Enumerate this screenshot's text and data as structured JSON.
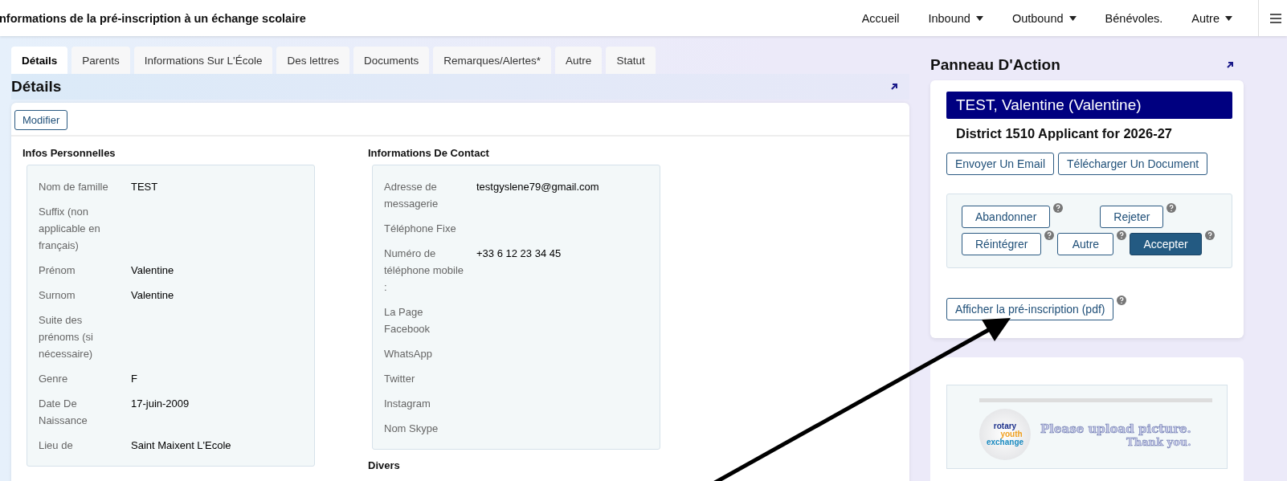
{
  "header": {
    "title": "nformations de la pré-inscription à un échange scolaire",
    "nav": [
      {
        "label": "Accueil",
        "dropdown": false
      },
      {
        "label": "Inbound",
        "dropdown": true
      },
      {
        "label": "Outbound",
        "dropdown": true
      },
      {
        "label": "Bénévoles.",
        "dropdown": false
      },
      {
        "label": "Autre",
        "dropdown": true
      }
    ]
  },
  "tabs": [
    {
      "label": "Détails",
      "selected": true
    },
    {
      "label": "Parents",
      "selected": false
    },
    {
      "label": "Informations Sur L'École",
      "selected": false
    },
    {
      "label": "Des lettres",
      "selected": false
    },
    {
      "label": "Documents",
      "selected": false
    },
    {
      "label": "Remarques/Alertes*",
      "selected": false
    },
    {
      "label": "Autre",
      "selected": false
    },
    {
      "label": "Statut",
      "selected": false
    }
  ],
  "section": {
    "title": "Détails",
    "edit_button": "Modifier"
  },
  "personal": {
    "title": "Infos Personnelles",
    "fields": [
      {
        "label": "Nom de famille",
        "value": "TEST"
      },
      {
        "label": "Suffix (non applicable en français)"
      },
      {
        "label": "Prénom",
        "value": "Valentine"
      },
      {
        "label": "Surnom",
        "value": "Valentine"
      },
      {
        "label": "Suite des prénoms (si nécessaire)"
      },
      {
        "label": "Genre",
        "value": "F"
      },
      {
        "label": "Date De Naissance",
        "value": "17-juin-2009"
      },
      {
        "label": "Lieu de",
        "value": "Saint Maixent L'Ecole"
      }
    ]
  },
  "contact": {
    "title": "Informations De Contact",
    "fields": [
      {
        "label": "Adresse de messagerie",
        "value": "testgyslene79@gmail.com"
      },
      {
        "label": "Téléphone Fixe"
      },
      {
        "label": "Numéro de téléphone mobile :",
        "value": "+33 6 12 23 34 45"
      },
      {
        "label": "La Page Facebook"
      },
      {
        "label": "WhatsApp"
      },
      {
        "label": "Twitter"
      },
      {
        "label": "Instagram"
      },
      {
        "label": "Nom Skype"
      }
    ]
  },
  "next_section": {
    "title": "Divers"
  },
  "action_panel": {
    "title": "Panneau D'Action",
    "name": "TEST, Valentine (Valentine)",
    "subtitle": "District 1510 Applicant for 2026-27",
    "buttons": [
      "Envoyer Un Email",
      "Télécharger Un Document"
    ],
    "status_actions": [
      [
        {
          "label": "Abandonner",
          "primary": false
        },
        {
          "label": "Rejeter",
          "primary": false
        }
      ],
      [
        {
          "label": "Réintégrer",
          "primary": false
        },
        {
          "label": "Autre",
          "primary": false
        },
        {
          "label": "Accepter",
          "primary": true
        }
      ]
    ],
    "pdf_button": "Afficher la pré-inscription (pdf)"
  },
  "photo": {
    "logo": [
      "rotary",
      "youth",
      "exchange"
    ],
    "message": "Please upload picture.",
    "thanks": "Thank you."
  }
}
